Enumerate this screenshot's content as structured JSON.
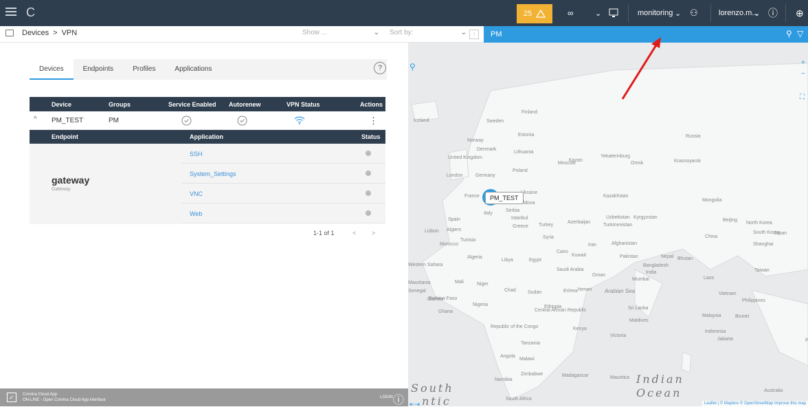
{
  "topbar": {
    "alert_count": "25",
    "infinity": "∞",
    "context": "monitoring",
    "user": "lorenzo.m..."
  },
  "subbar": {
    "breadcrumb_root": "Devices",
    "breadcrumb_sep": ">",
    "breadcrumb_leaf": "VPN",
    "show_placeholder": "Show ...",
    "sort_placeholder": "Sort by:",
    "filter_tag": "PM"
  },
  "tabs": [
    "Devices",
    "Endpoints",
    "Profiles",
    "Applications"
  ],
  "help": "?",
  "table": {
    "headers": [
      "Device",
      "Groups",
      "Service Enabled",
      "Autorenew",
      "VPN Status",
      "Actions"
    ],
    "row": {
      "device": "PM_TEST",
      "group": "PM",
      "actions": "⋮"
    },
    "sub_headers": [
      "Endpoint",
      "Application",
      "Status"
    ],
    "endpoint": {
      "name": "gateway",
      "type": "Gateway"
    },
    "applications": [
      "SSH",
      "System_Settings",
      "VNC",
      "Web"
    ]
  },
  "pager": {
    "range": "1-1 of 1",
    "prev": "<",
    "next": ">"
  },
  "footer": {
    "app": "Corvina Cloud App",
    "status": "ON-LINE - Open Corvina Cloud App interface",
    "login": "LOGIN"
  },
  "map": {
    "marker": "PM_TEST",
    "labels": [
      "Iceland",
      "Sweden",
      "Finland",
      "Norway",
      "Russia",
      "Estonia",
      "Denmark",
      "Lithuania",
      "Moscow",
      "Kazan",
      "Yekaterinburg",
      "Omsk",
      "Krasnoyarsk",
      "United Kingdom",
      "Poland",
      "London",
      "Germany",
      "Ukraine",
      "France",
      "Moldova",
      "Kazakhstan",
      "Mongolia",
      "Spain",
      "Italy",
      "Serbia",
      "Istanbul",
      "Uzbekistan",
      "Kyrgyzstan",
      "Lisbon",
      "Algiers",
      "Greece",
      "Turkey",
      "Azerbaijan",
      "Turkmenistan",
      "Beijing",
      "North Korea",
      "South Korea",
      "Japan",
      "Morocco",
      "Tunisia",
      "Syria",
      "Afghanistan",
      "China",
      "Iran",
      "Algeria",
      "Libya",
      "Egypt",
      "Cairo",
      "Kuwait",
      "Pakistan",
      "Nepal",
      "Bhutan",
      "Shanghai",
      "Western Sahara",
      "Saudi Arabia",
      "Bangladesh",
      "Taiwan",
      "Mauritania",
      "Mali",
      "Niger",
      "Oman",
      "Mumbai",
      "India",
      "Laos",
      "Senegal",
      "Chad",
      "Sudan",
      "Eritrea",
      "Yemen",
      "Vietnam",
      "Guinea",
      "Burkina Faso",
      "Nigeria",
      "Philippines",
      "Ghana",
      "Central African Republic",
      "Ethiopia",
      "Sri Lanka",
      "Malaysia",
      "Brunei",
      "Maldives",
      "Republic of the Congo",
      "Kenya",
      "Indonesia",
      "Tanzania",
      "Victoria",
      "Jakarta",
      "Angola",
      "Malawi",
      "Namibia",
      "Zimbabwe",
      "Madagascar",
      "Mauritius",
      "South Africa",
      "Australia",
      "Pap"
    ],
    "ocean_south": "South",
    "ocean_atlantic": "ntic",
    "ocean_indian": "Indian",
    "ocean_indian2": "Ocean",
    "arabian_sea": "Arabian Sea",
    "attribution": "Leaflet | © Mapbox © OpenStreetMap Improve this map",
    "zoom_in": "+",
    "zoom_out": "−"
  },
  "colors": {
    "nav": "#2f3e4e",
    "accent": "#2e9be0",
    "alert": "#f2b233"
  }
}
